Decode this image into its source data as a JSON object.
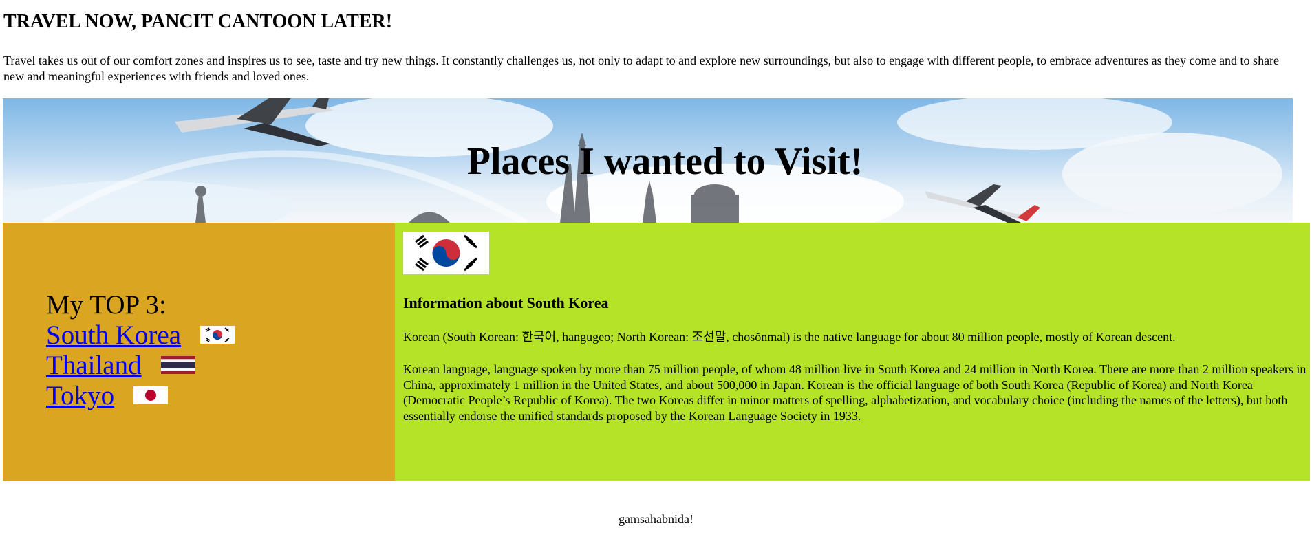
{
  "page": {
    "title": "TRAVEL NOW, PANCIT CANTOON LATER!",
    "intro": "Travel takes us out of our comfort zones and inspires us to see, taste and try new things. It constantly challenges us, not only to adapt to and explore new surroundings, but also to engage with different people, to embrace adventures as they come and to share new and meaningful experiences with friends and loved ones."
  },
  "banner": {
    "title": "Places I wanted to Visit!",
    "image": "airplanes-and-landmarks-sky-image"
  },
  "top3": {
    "heading": "My TOP 3:",
    "items": [
      {
        "label": "South Korea",
        "flag": "south-korea-flag"
      },
      {
        "label": "Thailand",
        "flag": "thailand-flag"
      },
      {
        "label": "Tokyo",
        "flag": "japan-flag"
      }
    ]
  },
  "info": {
    "flag": "south-korea-flag",
    "heading": "Information about South Korea",
    "paragraph1": "Korean (South Korean: 한국어, hangugeo; North Korean: 조선말, chosŏnmal) is the native language for about 80 million people, mostly of Korean descent.",
    "paragraph2": "Korean language, language spoken by more than 75 million people, of whom 48 million live in South Korea and 24 million in North Korea. There are more than 2 million speakers in China, approximately 1 million in the United States, and about 500,000 in Japan. Korean is the official language of both South Korea (Republic of Korea) and North Korea (Democratic People’s Republic of Korea). The two Koreas differ in minor matters of spelling, alphabetization, and vocabulary choice (including the names of the letters), but both essentially endorse the unified standards proposed by the Korean Language Society in 1933."
  },
  "footer": {
    "text": "gamsahabnida!"
  },
  "colors": {
    "left_panel": "#daa520",
    "right_panel": "#b4e328",
    "link": "#0000ee"
  }
}
